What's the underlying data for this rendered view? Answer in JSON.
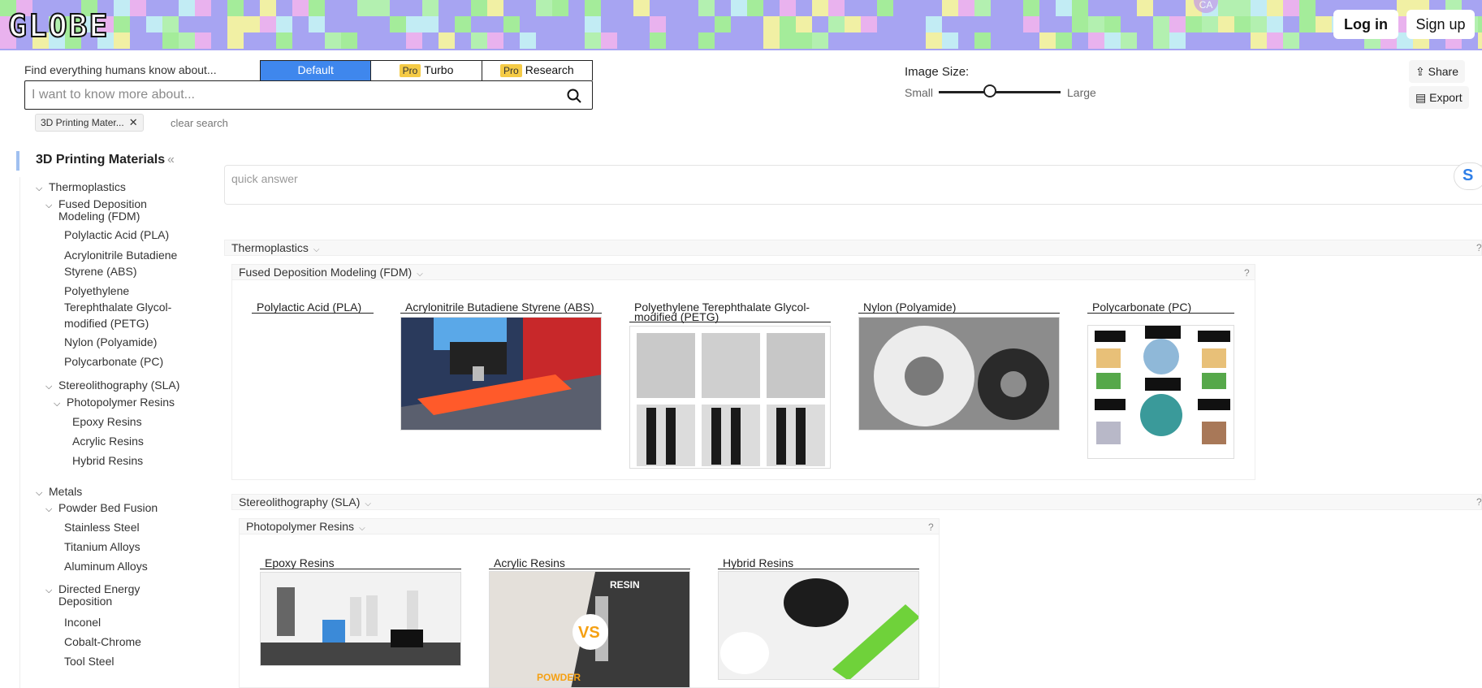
{
  "header": {
    "logo_text": "GLOBE",
    "login_label": "Log in",
    "signup_label": "Sign up",
    "avatar_text": "CA"
  },
  "search": {
    "find_label": "Find everything humans know about...",
    "modes": [
      {
        "label": "Default",
        "pro": ""
      },
      {
        "label": "Turbo",
        "pro": "Pro"
      },
      {
        "label": "Research",
        "pro": "Pro"
      }
    ],
    "placeholder": "I want to know more about...",
    "tag_label": "3D Printing Mater...",
    "clear_label": "clear search"
  },
  "image_size": {
    "label": "Image Size:",
    "small": "Small",
    "large": "Large",
    "value": 0.42
  },
  "actions": {
    "share": "Share",
    "export": "Export"
  },
  "sidebar": {
    "title": "3D Printing Materials",
    "items": [
      {
        "label": "Thermoplastics"
      },
      {
        "label": "Fused Deposition Modeling (FDM)"
      },
      {
        "label": "Polylactic Acid (PLA)"
      },
      {
        "label": "Acrylonitrile Butadiene Styrene (ABS)"
      },
      {
        "label": "Polyethylene Terephthalate Glycol-modified (PETG)"
      },
      {
        "label": "Nylon (Polyamide)"
      },
      {
        "label": "Polycarbonate (PC)"
      },
      {
        "label": "Stereolithography (SLA)"
      },
      {
        "label": "Photopolymer Resins"
      },
      {
        "label": "Epoxy Resins"
      },
      {
        "label": "Acrylic Resins"
      },
      {
        "label": "Hybrid Resins"
      },
      {
        "label": "Metals"
      },
      {
        "label": "Powder Bed Fusion"
      },
      {
        "label": "Stainless Steel"
      },
      {
        "label": "Titanium Alloys"
      },
      {
        "label": "Aluminum Alloys"
      },
      {
        "label": "Directed Energy Deposition"
      },
      {
        "label": "Inconel"
      },
      {
        "label": "Cobalt-Chrome"
      },
      {
        "label": "Tool Steel"
      }
    ]
  },
  "main": {
    "quick_answer": "quick answer",
    "help": "?",
    "sections": {
      "thermoplastics": "Thermoplastics",
      "fdm": "Fused Deposition Modeling (FDM)",
      "sla": "Stereolithography (SLA)",
      "photopolymer": "Photopolymer Resins"
    },
    "fdm_cards": [
      {
        "title": "Polylactic Acid (PLA)"
      },
      {
        "title": "Acrylonitrile Butadiene Styrene (ABS)"
      },
      {
        "title": "Polyethylene Terephthalate Glycol-modified (PETG)"
      },
      {
        "title": "Nylon (Polyamide)"
      },
      {
        "title": "Polycarbonate (PC)"
      }
    ],
    "resin_cards": [
      {
        "title": "Epoxy Resins"
      },
      {
        "title": "Acrylic Resins",
        "badge_top": "RESIN",
        "badge_mid": "VS",
        "badge_bottom": "POWDER"
      },
      {
        "title": "Hybrid Resins"
      }
    ]
  }
}
